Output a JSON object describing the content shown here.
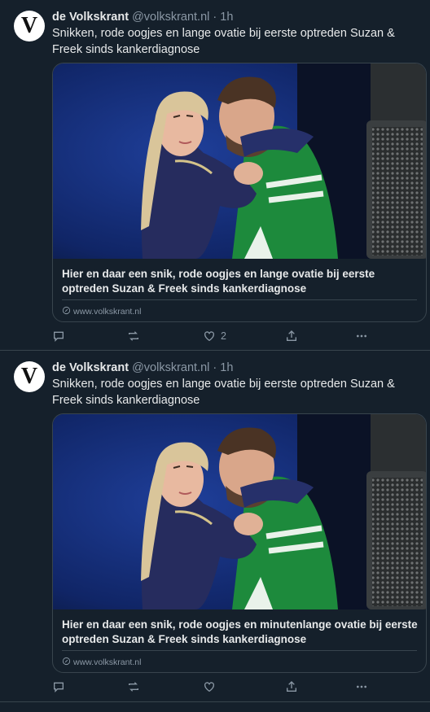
{
  "tweets": [
    {
      "author": "de Volkskrant",
      "handle": "@volkskrant.nl",
      "separator": "·",
      "time": "1h",
      "avatar_letter": "V",
      "text": "Snikken, rode oogjes en lange ovatie bij eerste optreden Suzan & Freek sinds kankerdiagnose",
      "card": {
        "title": "Hier en daar een snik, rode oogjes en lange ovatie bij eerste optreden Suzan & Freek sinds kankerdiagnose",
        "domain": "www.volkskrant.nl"
      },
      "actions": {
        "reply": "",
        "repost": "",
        "like": "2",
        "share": "",
        "more": ""
      }
    },
    {
      "author": "de Volkskrant",
      "handle": "@volkskrant.nl",
      "separator": "·",
      "time": "1h",
      "avatar_letter": "V",
      "text": "Snikken, rode oogjes en lange ovatie bij eerste optreden Suzan & Freek sinds kankerdiagnose",
      "card": {
        "title": "Hier en daar een snik, rode oogjes en minutenlange ovatie bij eerste optreden Suzan & Freek sinds kankerdiagnose",
        "domain": "www.volkskrant.nl"
      },
      "actions": {
        "reply": "",
        "repost": "",
        "like": "",
        "share": "",
        "more": ""
      }
    }
  ],
  "colors": {
    "background": "#15202b",
    "border": "#38444d",
    "text": "#e7e9ea",
    "muted": "#8b98a5"
  },
  "icons": [
    "reply-icon",
    "repost-icon",
    "like-icon",
    "share-icon",
    "more-icon",
    "link-icon"
  ]
}
